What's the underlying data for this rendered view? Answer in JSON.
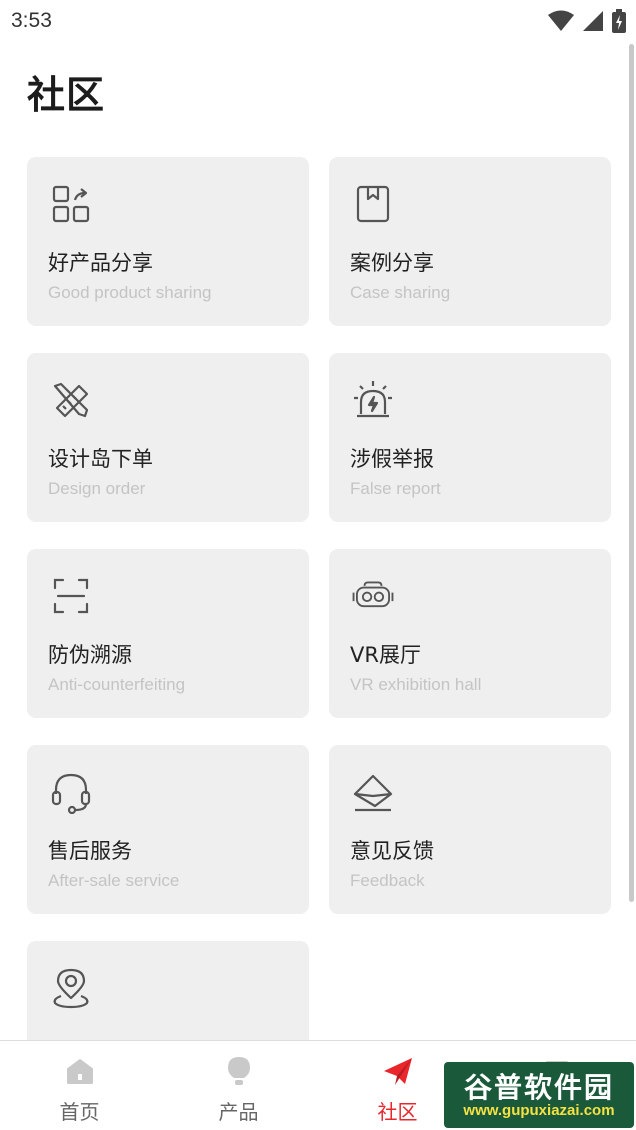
{
  "status_bar": {
    "time": "3:53"
  },
  "page": {
    "title": "社区"
  },
  "cards": [
    {
      "title": "好产品分享",
      "subtitle": "Good product sharing",
      "icon": "apps-share-icon"
    },
    {
      "title": "案例分享",
      "subtitle": "Case sharing",
      "icon": "bookmark-book-icon"
    },
    {
      "title": "设计岛下单",
      "subtitle": "Design order",
      "icon": "pencil-ruler-icon"
    },
    {
      "title": "涉假举报",
      "subtitle": "False report",
      "icon": "alarm-siren-icon"
    },
    {
      "title": "防伪溯源",
      "subtitle": "Anti-counterfeiting",
      "icon": "scan-frame-icon"
    },
    {
      "title": "VR展厅",
      "subtitle": "VR exhibition hall",
      "icon": "vr-headset-icon"
    },
    {
      "title": "售后服务",
      "subtitle": "After-sale service",
      "icon": "headset-icon"
    },
    {
      "title": "意见反馈",
      "subtitle": "Feedback",
      "icon": "envelope-feedback-icon"
    },
    {
      "title": "",
      "subtitle": "",
      "icon": "location-pin-icon"
    }
  ],
  "tabs": [
    {
      "label": "首页",
      "icon": "home-icon",
      "active": false
    },
    {
      "label": "产品",
      "icon": "bulb-icon",
      "active": false
    },
    {
      "label": "社区",
      "icon": "paper-plane-icon",
      "active": true
    },
    {
      "label": "",
      "icon": "user-card-icon",
      "active": false
    }
  ],
  "watermark": {
    "main": "谷普软件园",
    "url": "www.gupuxiazai.com"
  },
  "colors": {
    "accent": "#e8262c",
    "card_bg": "#efefef",
    "subtitle": "#c4c4c4",
    "icon_stroke": "#555555"
  }
}
